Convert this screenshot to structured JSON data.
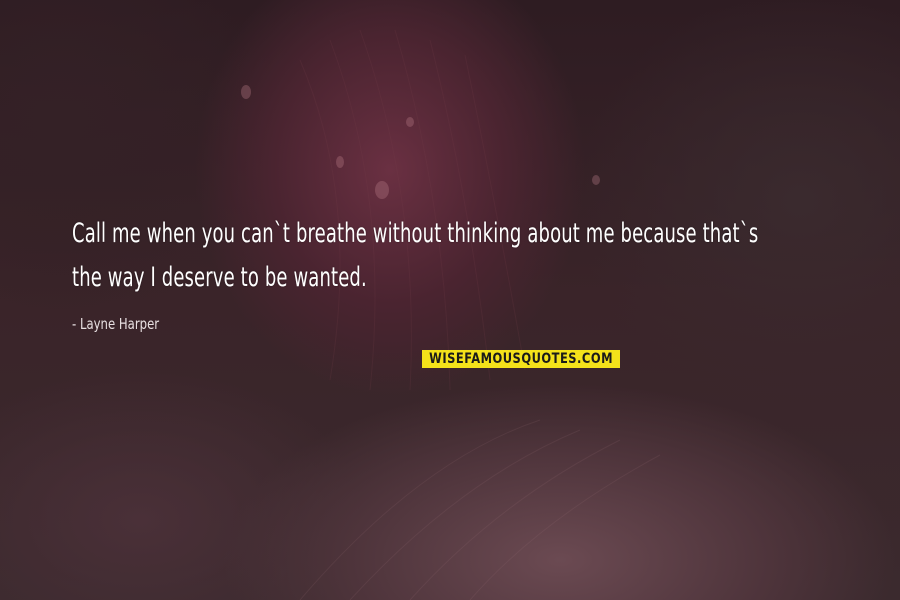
{
  "quote": {
    "line1": "Call me when you can`t breathe without thinking about me because that`s",
    "line2": "the way I deserve to be wanted.",
    "author": "- Layne Harper"
  },
  "watermark": {
    "text": "WISEFAMOUSQUOTES.COM",
    "background": "#f4e21a",
    "text_color": "#1a1a1a"
  },
  "colors": {
    "text": "#ffffff",
    "background": "#2a1a20"
  }
}
